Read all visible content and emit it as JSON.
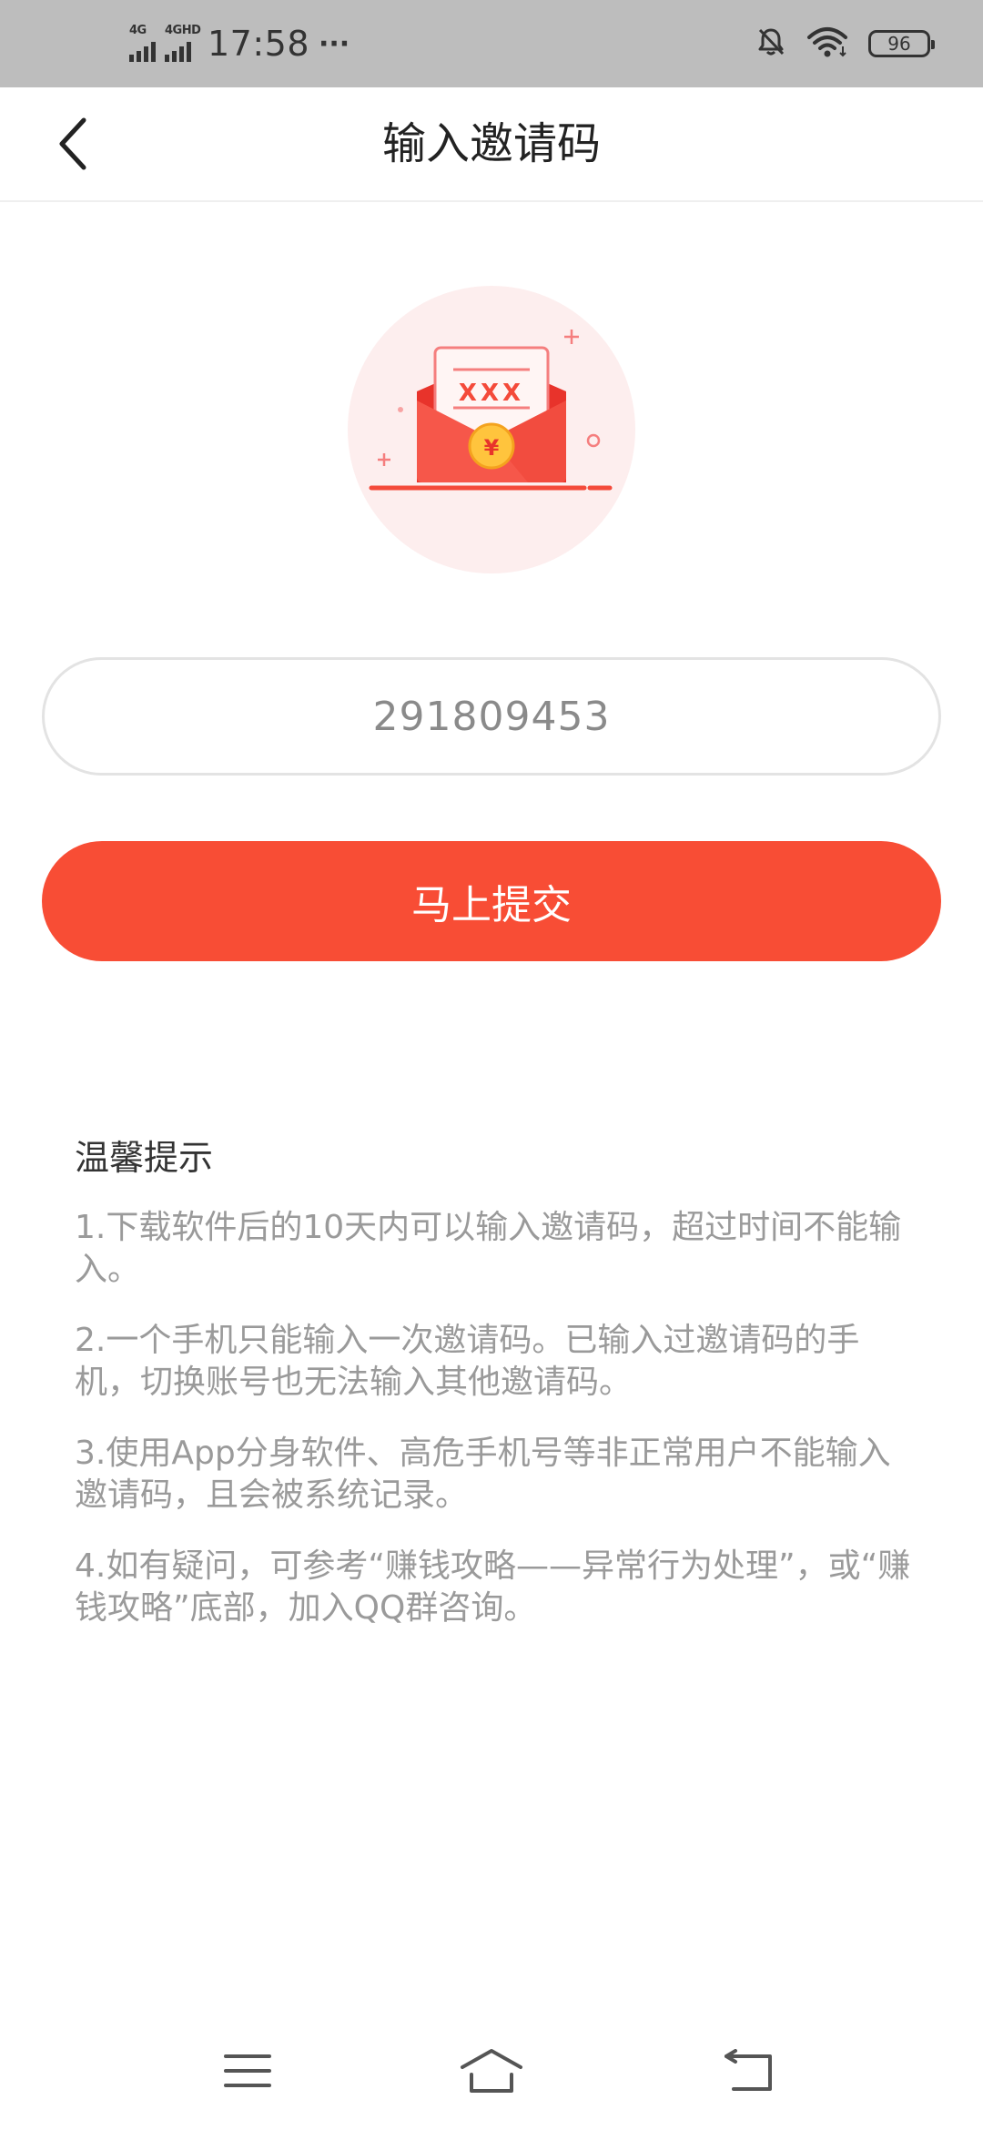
{
  "status_bar": {
    "network_1": "4G",
    "network_2": "4GHD",
    "time": "17:58",
    "more": "···",
    "battery": "96",
    "icons": [
      "signal-icon",
      "bell-off-icon",
      "wifi-icon",
      "battery-icon"
    ]
  },
  "nav": {
    "title": "输入邀请码",
    "back_icon": "chevron-left-icon"
  },
  "illustration": {
    "icon": "red-envelope-icon",
    "letter_text": "XXX",
    "coin_text": "¥"
  },
  "invite": {
    "value": "291809453",
    "placeholder": ""
  },
  "submit": {
    "label": "马上提交"
  },
  "tips": {
    "title": "温馨提示",
    "items": [
      "1.下载软件后的10天内可以输入邀请码，超过时间不能输入。",
      "2.一个手机只能输入一次邀请码。已输入过邀请码的手机，切换账号也无法输入其他邀请码。",
      "3.使用App分身软件、高危手机号等非正常用户不能输入邀请码，且会被系统记录。",
      "4.如有疑问，可参考“赚钱攻略——异常行为处理”，或“赚钱攻略”底部，加入QQ群咨询。"
    ]
  },
  "system_nav": {
    "icons": [
      "menu-icon",
      "home-icon",
      "back-icon"
    ]
  },
  "colors": {
    "accent": "#f84d35",
    "status_bar_bg": "#bdbdbd",
    "tip_text": "#9a9a9a"
  }
}
